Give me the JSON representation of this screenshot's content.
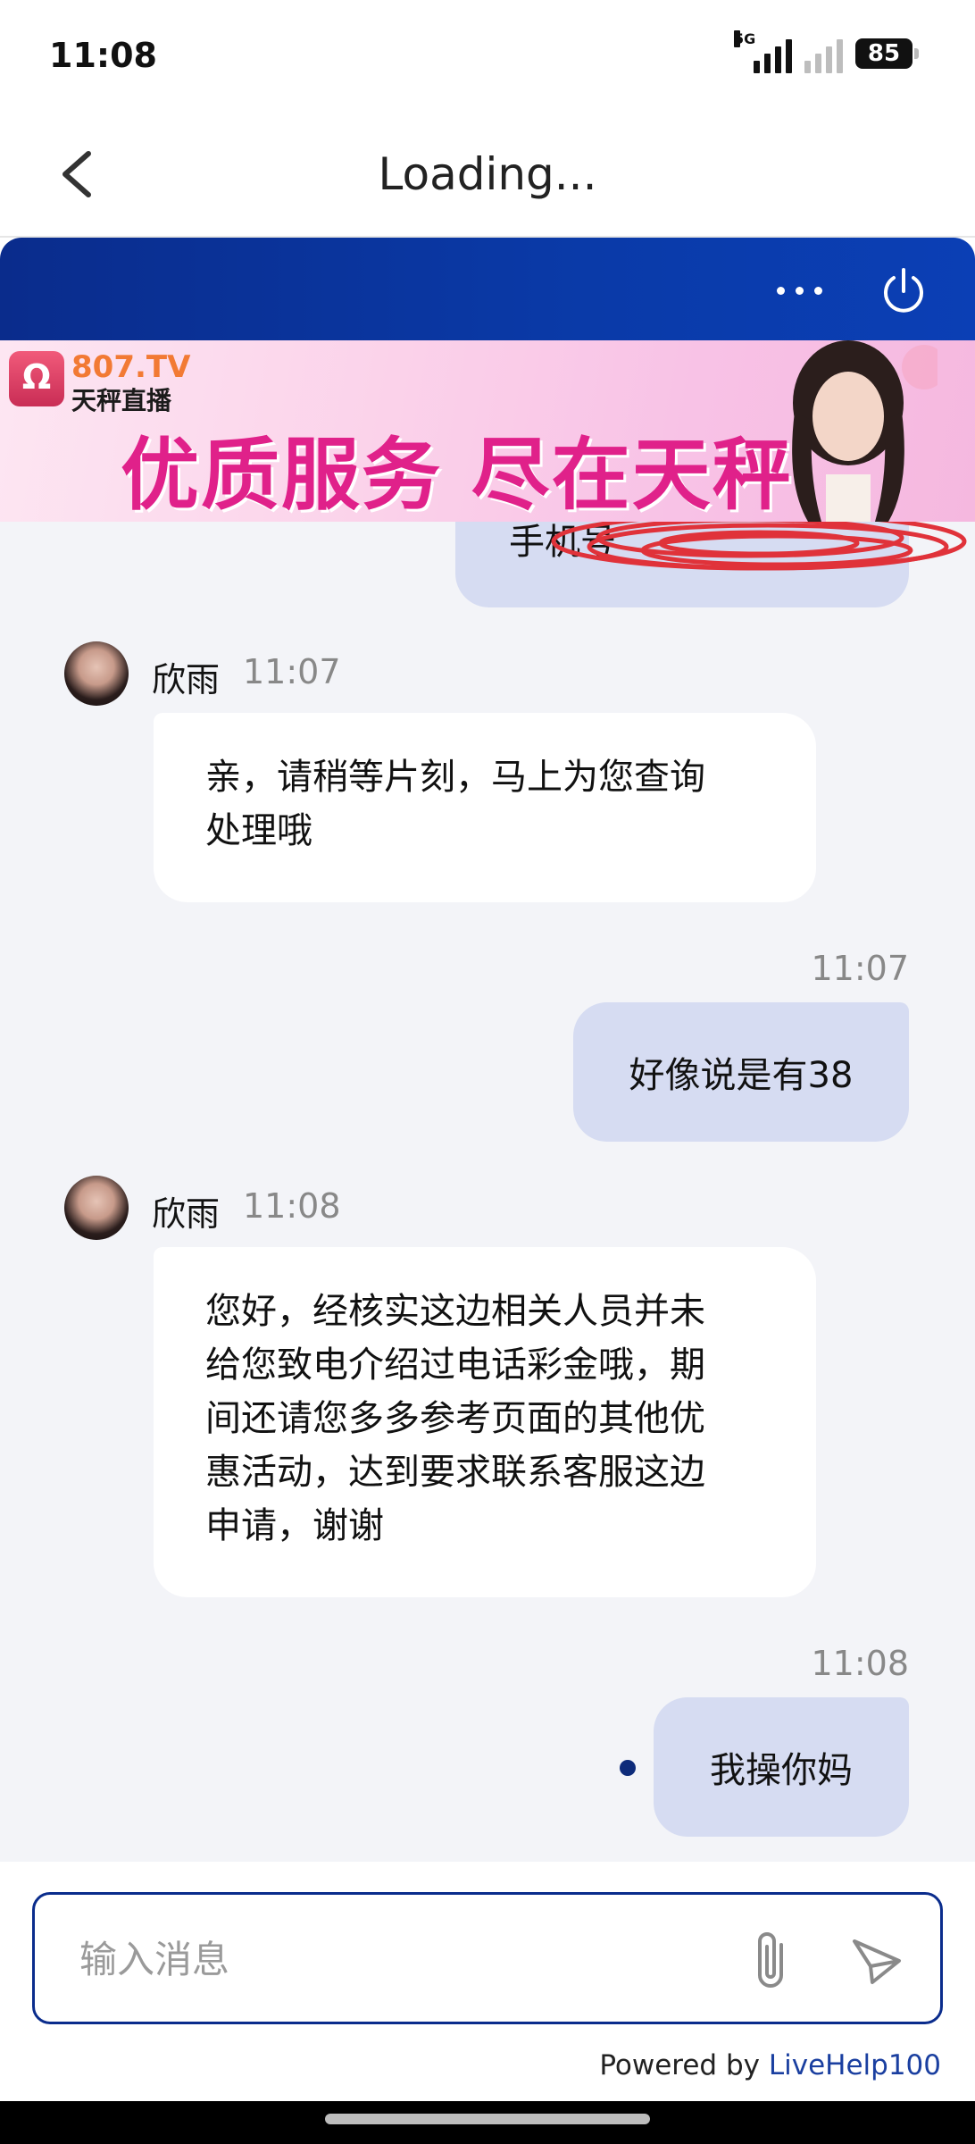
{
  "status_bar": {
    "time": "11:08",
    "network_label": "5G",
    "battery": "85"
  },
  "nav": {
    "title": "Loading..."
  },
  "banner": {
    "brand": "807.TV",
    "subtitle": "天秤直播",
    "slogan": "优质服务 尽在天秤",
    "logo_mark": "Ω"
  },
  "chat": {
    "partial_message": "手机号",
    "messages": [
      {
        "type": "agent",
        "name": "欣雨",
        "time": "11:07",
        "text": "亲，请稍等片刻，马上为您查询\n处理哦"
      },
      {
        "type": "user",
        "time": "11:07",
        "text": "好像说是有38"
      },
      {
        "type": "agent",
        "name": "欣雨",
        "time": "11:08",
        "text": "您好，经核实这边相关人员并未\n给您致电介绍过电话彩金哦，期\n间还请您多多参考页面的其他优\n惠活动，达到要求联系客服这边\n申请，谢谢"
      },
      {
        "type": "user",
        "time": "11:08",
        "text": "我操你妈"
      }
    ]
  },
  "composer": {
    "placeholder": "输入消息"
  },
  "footer": {
    "powered_prefix": "Powered by ",
    "powered_link": "LiveHelp100"
  },
  "colors": {
    "header_blue": "#0a2c8c",
    "user_bubble": "#d6dcf2",
    "chat_bg": "#f3f4f8",
    "link_blue": "#1a3fa0"
  }
}
